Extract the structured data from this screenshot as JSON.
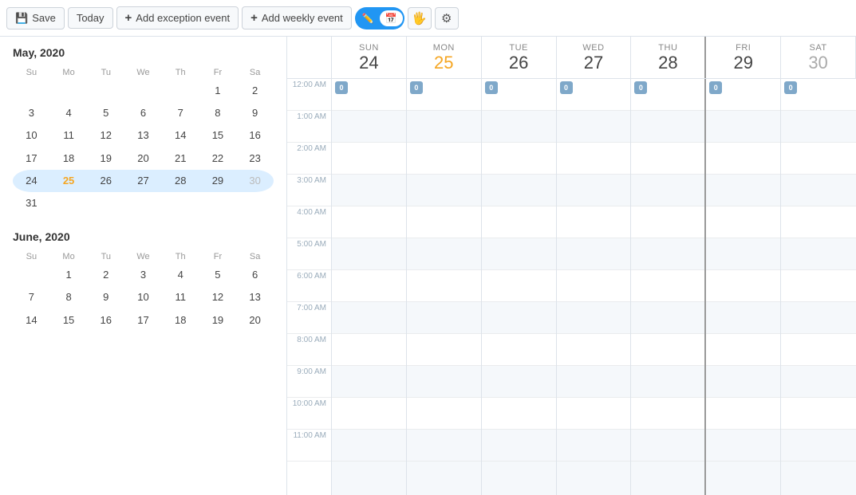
{
  "toolbar": {
    "save_label": "Save",
    "today_label": "Today",
    "add_exception_label": "Add exception event",
    "add_weekly_label": "Add weekly event"
  },
  "toggle": {
    "option1_icon": "✏️",
    "option2_icon": "📅",
    "option3_icon": "🤚",
    "option4_icon": "⚙️"
  },
  "may2020": {
    "title": "May, 2020",
    "dow": [
      "Su",
      "Mo",
      "Tu",
      "We",
      "Th",
      "Fr",
      "Sa"
    ],
    "weeks": [
      [
        null,
        null,
        null,
        null,
        null,
        1,
        2
      ],
      [
        3,
        4,
        5,
        6,
        7,
        8,
        9
      ],
      [
        10,
        11,
        12,
        13,
        14,
        15,
        16
      ],
      [
        17,
        18,
        19,
        20,
        21,
        22,
        23
      ],
      [
        24,
        25,
        26,
        27,
        28,
        29,
        30
      ],
      [
        31,
        null,
        null,
        null,
        null,
        null,
        null
      ]
    ],
    "today": 25,
    "active_week": 4
  },
  "june2020": {
    "title": "June, 2020",
    "dow": [
      "Su",
      "Mo",
      "Tu",
      "We",
      "Th",
      "Fr",
      "Sa"
    ],
    "weeks": [
      [
        null,
        1,
        2,
        3,
        4,
        5,
        6
      ],
      [
        7,
        8,
        9,
        10,
        11,
        12,
        13
      ],
      [
        14,
        15,
        16,
        17,
        18,
        19,
        20
      ]
    ]
  },
  "week_header": {
    "days": [
      {
        "dow": "Sun",
        "num": "24",
        "today": false
      },
      {
        "dow": "Mon",
        "num": "25",
        "today": true
      },
      {
        "dow": "Tue",
        "num": "26",
        "today": false
      },
      {
        "dow": "Wed",
        "num": "27",
        "today": false
      },
      {
        "dow": "Thu",
        "num": "28",
        "today": false
      },
      {
        "dow": "Fri",
        "num": "29",
        "today": false
      },
      {
        "dow": "Sat",
        "num": "30",
        "today": false
      }
    ]
  },
  "time_slots": [
    "12:00 AM",
    "1:00 AM",
    "2:00 AM",
    "3:00 AM",
    "4:00 AM",
    "5:00 AM",
    "6:00 AM",
    "7:00 AM",
    "8:00 AM",
    "9:00 AM",
    "10:00 AM",
    "11:00 AM"
  ]
}
